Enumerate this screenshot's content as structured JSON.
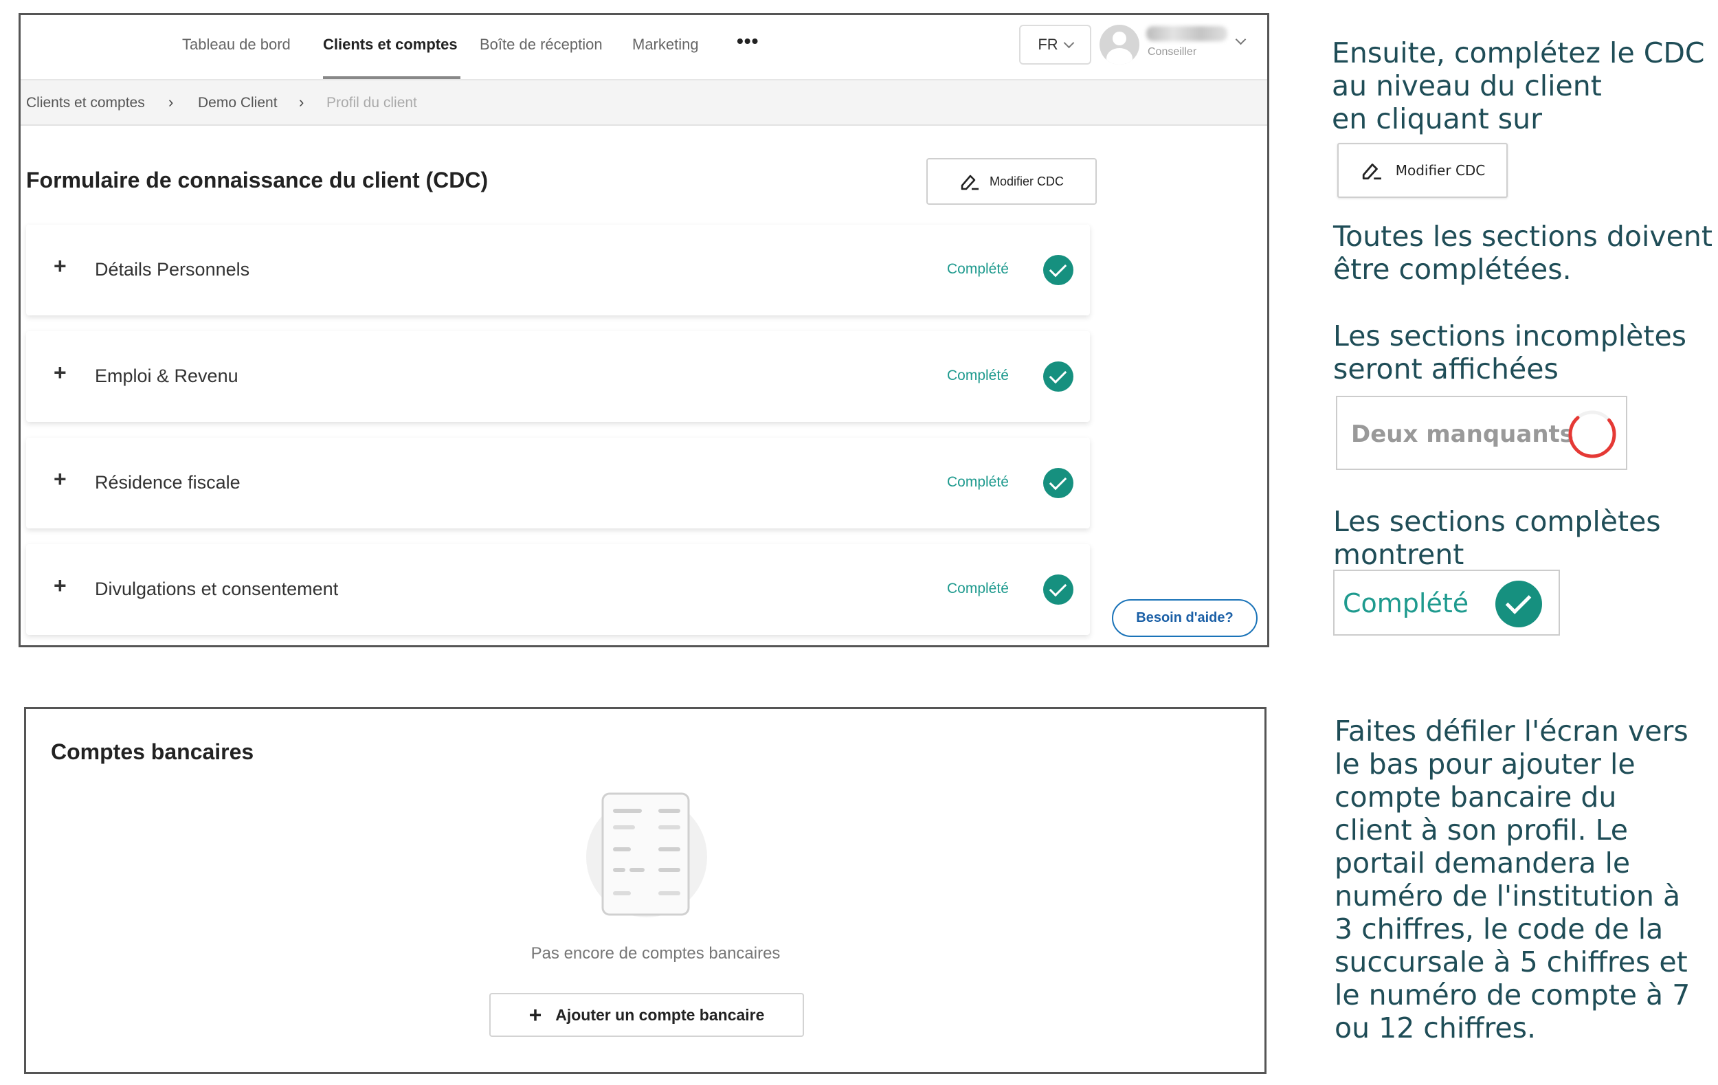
{
  "nav": {
    "tabs": [
      "Tableau de bord",
      "Clients et comptes",
      "Boîte de réception",
      "Marketing"
    ],
    "more": "•••",
    "language": "FR",
    "user_role": "Conseiller"
  },
  "breadcrumb": [
    "Clients et comptes",
    "Demo Client",
    "Profil du client"
  ],
  "breadcrumb_sep": "›",
  "form": {
    "title": "Formulaire de connaissance du client (CDC)",
    "modify_label": "Modifier CDC",
    "sections": [
      {
        "title": "Détails Personnels",
        "status": "Complété"
      },
      {
        "title": "Emploi & Revenu",
        "status": "Complété"
      },
      {
        "title": "Résidence fiscale",
        "status": "Complété"
      },
      {
        "title": "Divulgations et consentement",
        "status": "Complété"
      }
    ],
    "plus": "+"
  },
  "help_label": "Besoin d'aide?",
  "bank": {
    "title": "Comptes bancaires",
    "empty_text": "Pas encore de comptes bancaires",
    "add_label": "Ajouter un compte bancaire",
    "plus": "+"
  },
  "notes": {
    "cdc_intro": "Ensuite, complétez le CDC\nau niveau du client\nen cliquant sur",
    "modify_label": "Modifier CDC",
    "all_sections": "Toutes les sections doivent\nêtre complétées.",
    "incomplete": "Les sections incomplètes\nseront affichées",
    "missing_label": "Deux manquants",
    "complete": "Les sections complètes\nmontrent",
    "complete_label": "Complété",
    "scroll": "Faites défiler l'écran vers\nle bas pour ajouter le\ncompte bancaire du\nclient à son profil. Le\nportail demandera le\nnuméro de l'institution à\n3 chiffres, le code de la\nsuccursale à 5 chiffres et\nle numéro de compte à 7\nou 12 chiffres."
  },
  "colors": {
    "accent_teal": "#16907f",
    "text_teal": "#1e9a8e",
    "note_text": "#1f4d57",
    "help_blue": "#1a73b8",
    "missing_red": "#e53935"
  }
}
